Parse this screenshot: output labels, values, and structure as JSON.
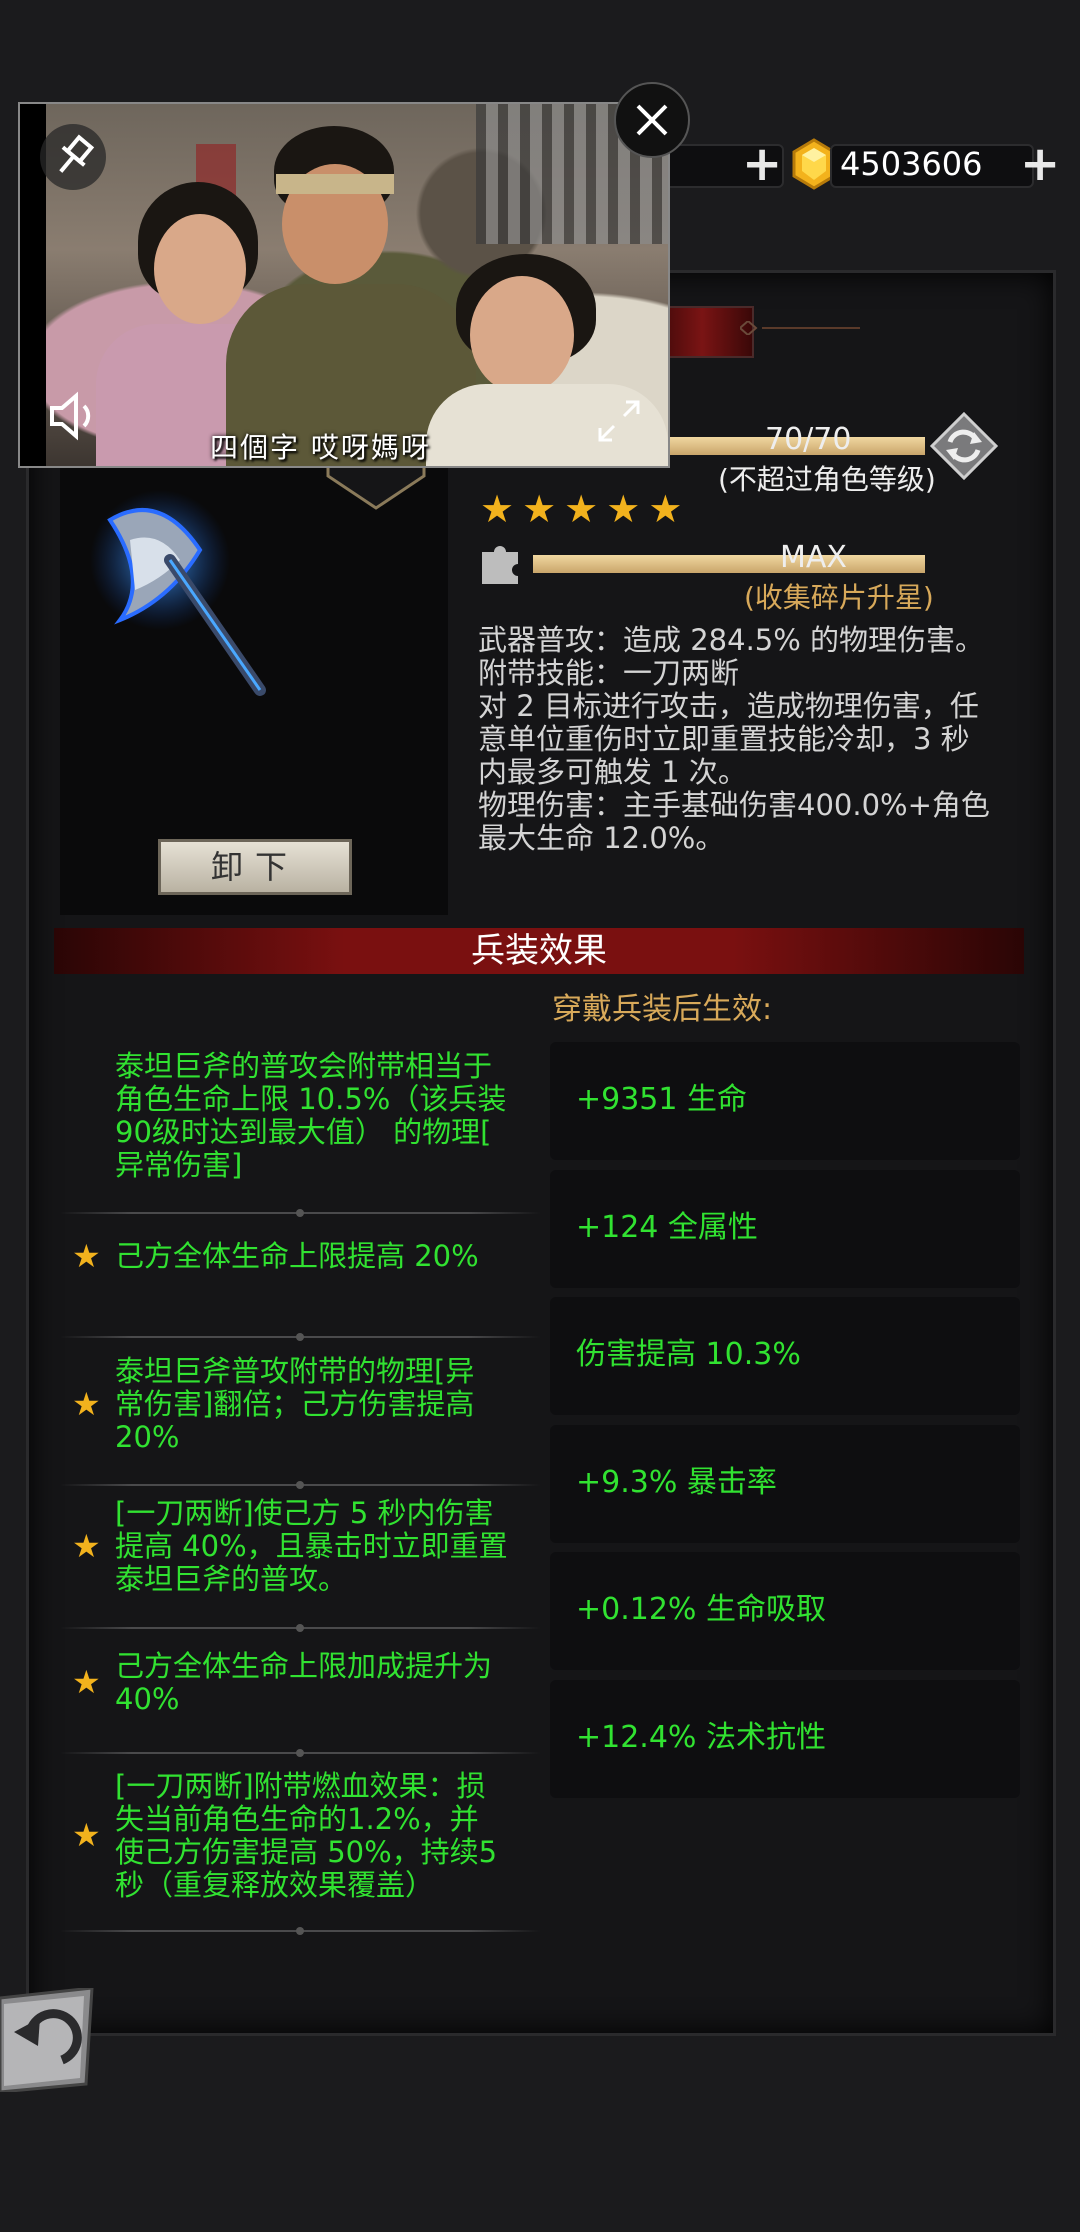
{
  "top_bar": {
    "gold_amount": "4503606",
    "icons": [
      "plus-icon",
      "gem-icon",
      "plus-icon"
    ]
  },
  "popup_video": {
    "subtitle": "四個字 哎呀媽呀",
    "icons": [
      "pin-icon",
      "close-icon",
      "volume-icon",
      "expand-icon"
    ]
  },
  "weapon": {
    "level_text": "70/70",
    "level_progress": 1.0,
    "level_note": "(不超过角色等级)",
    "stars": 5,
    "shard_text": "MAX",
    "shard_progress": 1.0,
    "shard_note": "(收集碎片升星)",
    "description": [
      "武器普攻：造成 284.5% 的物理伤害。",
      "附带技能：一刀两断",
      "对 2 目标进行攻击，造成物理伤害，任",
      "意单位重伤时立即重置技能冷却，3 秒",
      "内最多可触发 1 次。",
      "物理伤害：主手基础伤害400.0%+角色",
      "最大生命 12.0%。"
    ],
    "unequip_button": "卸下"
  },
  "effects_section": {
    "title": "兵装效果",
    "stats_header": "穿戴兵装后生效:",
    "effects": [
      {
        "star": false,
        "lines": [
          "泰坦巨斧的普攻会附带相当于",
          "角色生命上限 10.5%（该兵装",
          "90级时达到最大值） 的物理[",
          "异常伤害]"
        ]
      },
      {
        "star": true,
        "lines": [
          "己方全体生命上限提高 20%"
        ]
      },
      {
        "star": true,
        "lines": [
          "泰坦巨斧普攻附带的物理[异",
          "常伤害]翻倍；己方伤害提高",
          "20%"
        ]
      },
      {
        "star": true,
        "lines": [
          "[一刀两断]使己方 5 秒内伤害",
          "提高 40%，且暴击时立即重置",
          "泰坦巨斧的普攻。"
        ]
      },
      {
        "star": true,
        "lines": [
          "己方全体生命上限加成提升为",
          "40%"
        ]
      },
      {
        "star": true,
        "lines": [
          "[一刀两断]附带燃血效果：损",
          "失当前角色生命的1.2%，并",
          "使己方伤害提高 50%，持续5",
          "秒（重复释放效果覆盖）"
        ]
      }
    ],
    "stats": [
      "+9351 生命",
      "+124 全属性",
      "伤害提高 10.3%",
      "+9.3% 暴击率",
      "+0.12% 生命吸取",
      "+12.4% 法术抗性"
    ]
  },
  "colors": {
    "effect_green": "#31e231",
    "star_gold": "#f2b21d",
    "ribbon_red": "#7a1414",
    "note_orange": "#d8a95a"
  }
}
